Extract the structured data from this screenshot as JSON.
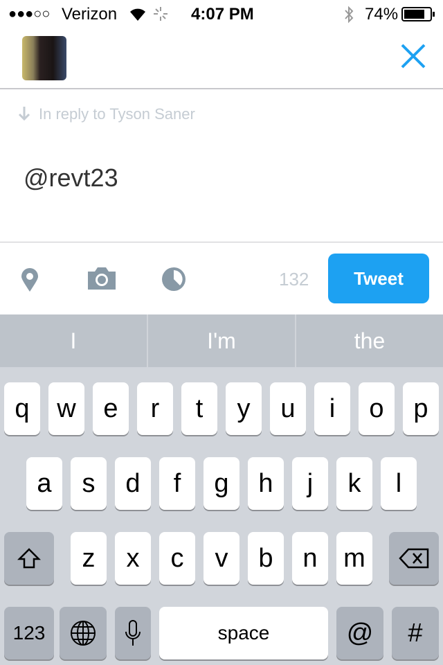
{
  "status": {
    "signal": "●●●○○",
    "carrier": "Verizon",
    "time": "4:07 PM",
    "battery": "74%",
    "battery_level": 74
  },
  "header": {
    "close_icon": "close-icon",
    "accent": "#1da1f2"
  },
  "compose": {
    "reply_label": "In reply to Tyson Saner",
    "text": "@revt23"
  },
  "toolbar": {
    "char_count": "132",
    "tweet_label": "Tweet"
  },
  "suggestions": [
    "I",
    "I'm",
    "the"
  ],
  "keyboard": {
    "row1": [
      "q",
      "w",
      "e",
      "r",
      "t",
      "y",
      "u",
      "i",
      "o",
      "p"
    ],
    "row2": [
      "a",
      "s",
      "d",
      "f",
      "g",
      "h",
      "j",
      "k",
      "l"
    ],
    "row3": [
      "z",
      "x",
      "c",
      "v",
      "b",
      "n",
      "m"
    ],
    "numbers": "123",
    "space": "space",
    "at": "@",
    "hash": "#"
  }
}
